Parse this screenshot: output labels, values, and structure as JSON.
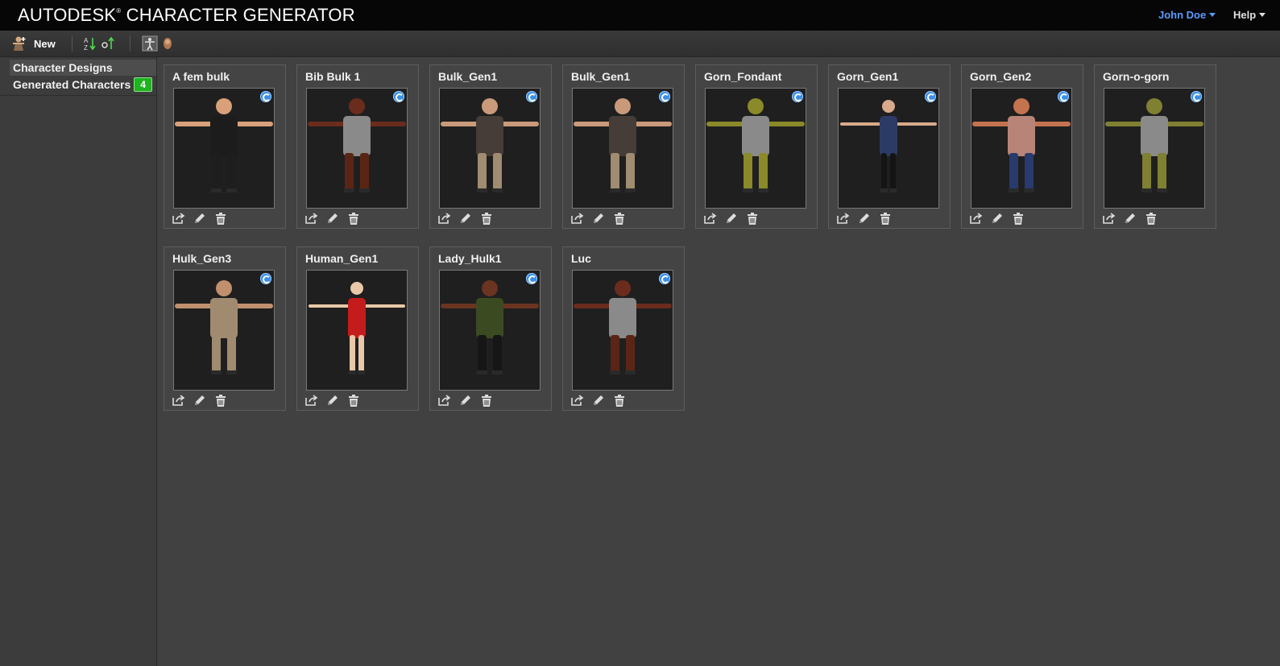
{
  "header": {
    "brand": "AUTODESK",
    "brand_mark": "®",
    "product": "CHARACTER GENERATOR",
    "user": "John Doe",
    "help": "Help"
  },
  "toolbar": {
    "new_label": "New",
    "icons": [
      "new-character-icon",
      "sort-alpha-icon",
      "sort-date-icon",
      "full-body-view-icon",
      "head-view-icon"
    ]
  },
  "sidebar": {
    "items": [
      {
        "label": "Character Designs",
        "active": true
      },
      {
        "label": "Generated Characters",
        "badge": "4",
        "active": false
      }
    ]
  },
  "cards": [
    {
      "name": "A fem bulk",
      "skin": "#d9a07a",
      "top": "#1c1c1c",
      "legs": "#1e1e1e",
      "synced": true
    },
    {
      "name": "Bib Bulk 1",
      "skin": "#6a2c1c",
      "top": "#8a8a8a",
      "legs": "#5a2515",
      "synced": true
    },
    {
      "name": "Bulk_Gen1",
      "skin": "#c99a7a",
      "top": "#463c38",
      "legs": "#a08c70",
      "synced": true
    },
    {
      "name": "Bulk_Gen1",
      "skin": "#c99a7a",
      "top": "#463c38",
      "legs": "#a08c70",
      "synced": true
    },
    {
      "name": "Gorn_Fondant",
      "skin": "#8a8a2a",
      "top": "#8a8a8a",
      "legs": "#8a8a2a",
      "synced": true
    },
    {
      "name": "Gorn_Gen1",
      "skin": "#d8a98a",
      "top": "#2c3a66",
      "legs": "#141414",
      "synced": true
    },
    {
      "name": "Gorn_Gen2",
      "skin": "#c4734f",
      "top": "#b88478",
      "legs": "#283a6e",
      "synced": true
    },
    {
      "name": "Gorn-o-gorn",
      "skin": "#7f8032",
      "top": "#8a8a8a",
      "legs": "#7f8032",
      "synced": true
    },
    {
      "name": "Hulk_Gen3",
      "skin": "#c0906e",
      "top": "#a08a70",
      "legs": "#a08a70",
      "synced": true
    },
    {
      "name": "Human_Gen1",
      "skin": "#e8c8a8",
      "top": "#c41c1c",
      "legs": "#e8c8a8",
      "synced": false
    },
    {
      "name": "Lady_Hulk1",
      "skin": "#6a3420",
      "top": "#3c4a22",
      "legs": "#161616",
      "synced": true
    },
    {
      "name": "Luc",
      "skin": "#6a2c1c",
      "top": "#8a8a8a",
      "legs": "#5a2515",
      "synced": true
    }
  ]
}
